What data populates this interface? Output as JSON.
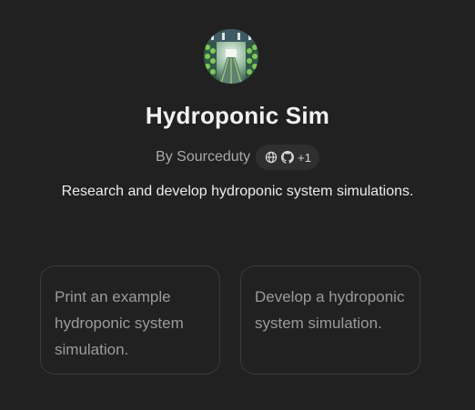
{
  "gpt": {
    "title": "Hydroponic Sim",
    "author_prefix": "By Sourceduty",
    "links": {
      "extra_count": "+1",
      "icons": [
        "globe-icon",
        "github-icon"
      ]
    },
    "description": "Research and develop hydroponic system simulations."
  },
  "starters": [
    {
      "label": "Print an example hydroponic system simulation."
    },
    {
      "label": "Develop a hydroponic system simulation."
    }
  ]
}
